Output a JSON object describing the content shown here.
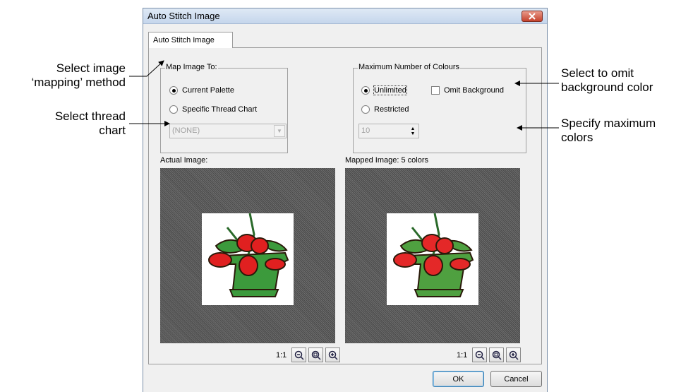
{
  "callouts": {
    "mapping_method": [
      "Select image",
      "‘mapping’ method"
    ],
    "thread_chart": [
      "Select thread",
      "chart"
    ],
    "omit_background": [
      "Select to omit",
      "background color"
    ],
    "max_colors": [
      "Specify maximum",
      "colors"
    ]
  },
  "dialog": {
    "title": "Auto Stitch Image",
    "tab_label": "Auto Stitch Image",
    "map_group": {
      "legend": "Map Image To:",
      "option_current": "Current Palette",
      "option_specific": "Specific Thread Chart",
      "selected": "Current Palette",
      "thread_chart_value": "(NONE)"
    },
    "colours_group": {
      "legend": "Maximum Number of Colours",
      "option_unlimited": "Unlimited",
      "option_restricted": "Restricted",
      "selected": "Unlimited",
      "omit_background_label": "Omit Background",
      "omit_background_checked": false,
      "max_value": "10"
    },
    "actual_image": {
      "label": "Actual Image:",
      "zoom_label": "1:1"
    },
    "mapped_image": {
      "label": "Mapped Image: 5 colors",
      "zoom_label": "1:1"
    },
    "ok_label": "OK",
    "cancel_label": "Cancel"
  },
  "colors": {
    "title_bar": "#c5d6ec",
    "close_button": "#c5422d",
    "flower_red": "#e02020",
    "leaf_green": "#3c9a3c",
    "pot_green": "#4fa040"
  },
  "icons": [
    "close-icon",
    "zoom-out-icon",
    "zoom-fit-icon",
    "zoom-in-icon",
    "spin-up-icon",
    "spin-down-icon",
    "dropdown-arrow-icon"
  ]
}
